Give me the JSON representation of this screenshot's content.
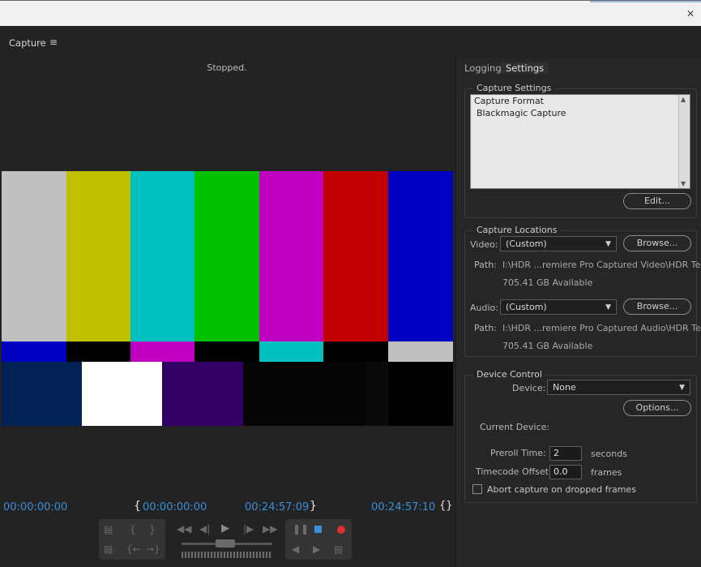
{
  "topbar": {
    "close_glyph": "✕"
  },
  "panel": {
    "title": "Capture",
    "menu_icon": "≡",
    "status": "Stopped."
  },
  "colors": {
    "row1": [
      "#c0c0c0",
      "#c0c000",
      "#00c0c0",
      "#00c000",
      "#c000c0",
      "#c00000",
      "#0000c0"
    ],
    "row2": [
      "#0000c0",
      "#000000",
      "#c000c0",
      "#000000",
      "#00c0c0",
      "#000000",
      "#c0c0c0"
    ],
    "row3": [
      "#002255",
      "#ffffff",
      "#330066",
      "#050505",
      "#000000",
      "#0a0a0a",
      "#000000"
    ],
    "timecode": "#3b8ed8",
    "stop": "#3b8ed8",
    "record": "#e03030"
  },
  "tabs": [
    {
      "label": "Logging"
    },
    {
      "label": "Settings"
    }
  ],
  "capture_settings": {
    "title": "Capture Settings",
    "format_label": "Capture Format",
    "format_value": "Blackmagic Capture",
    "edit_button": "Edit..."
  },
  "capture_locations": {
    "title": "Capture Locations",
    "video_label": "Video:",
    "video_value": "(Custom)",
    "browse_label": "Browse...",
    "path_label": "Path:",
    "video_path": "I:\\HDR ...remiere Pro Captured Video\\HDR Test",
    "video_available": "705.41 GB Available",
    "audio_label": "Audio:",
    "audio_value": "(Custom)",
    "audio_path": "I:\\HDR ...remiere Pro Captured Audio\\HDR Test",
    "audio_available": "705.41 GB Available"
  },
  "device_control": {
    "title": "Device Control",
    "device_label": "Device:",
    "device_value": "None",
    "options_button": "Options...",
    "current_device_label": "Current Device:",
    "preroll_label": "Preroll Time:",
    "preroll_value": "2",
    "preroll_unit": "seconds",
    "tc_offset_label": "Timecode Offset:",
    "tc_offset_value": "0.0",
    "tc_offset_unit": "frames",
    "abort_label": "Abort capture on dropped frames",
    "abort_checked": false
  },
  "timecodes": {
    "current": "00:00:00:00",
    "in_point": "00:00:00:00",
    "out_point": "00:24:57:09",
    "duration": "00:24:57:10"
  }
}
